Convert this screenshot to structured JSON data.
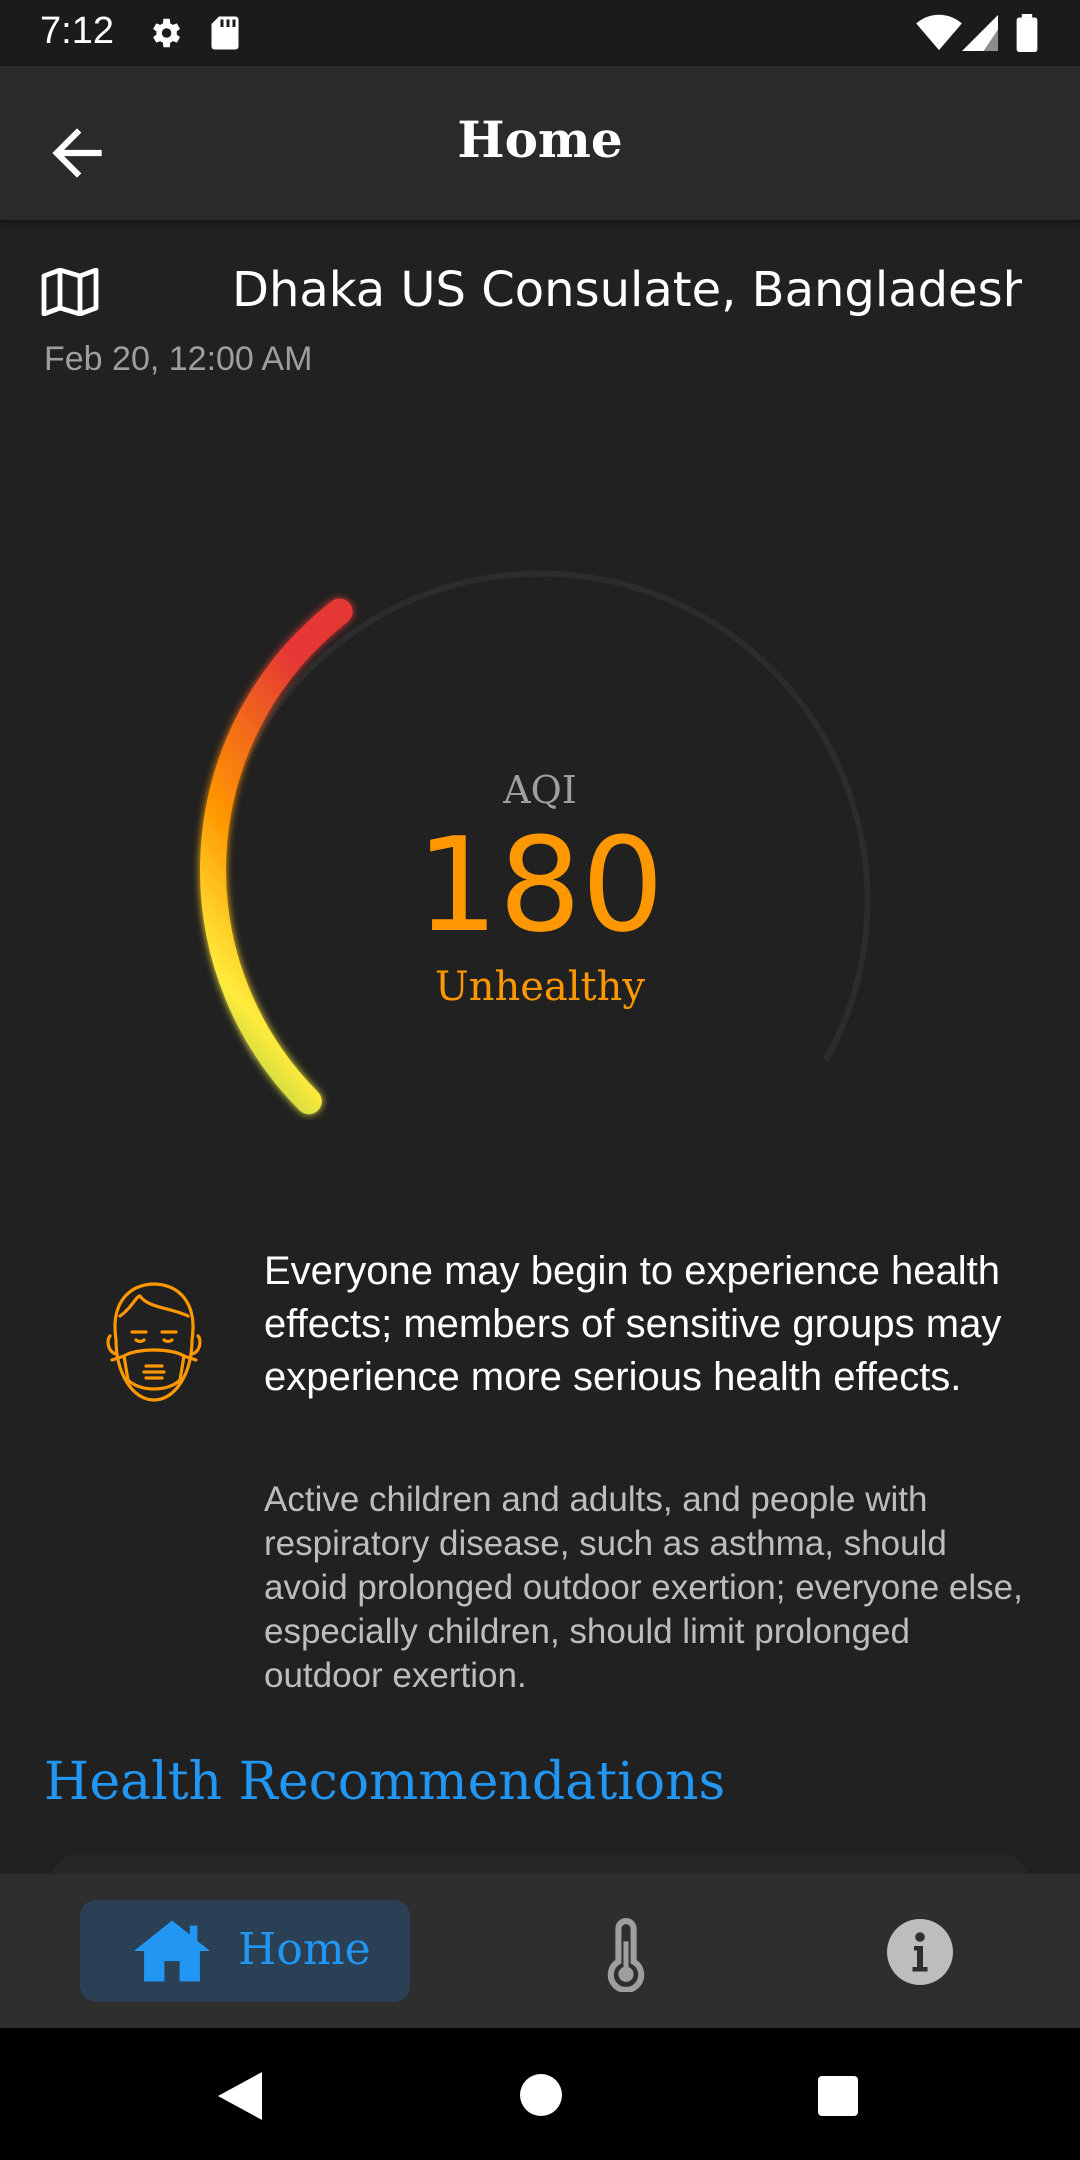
{
  "status_bar": {
    "time": "7:12"
  },
  "app_bar": {
    "title": "Home"
  },
  "location": {
    "name": "Dhaka US Consulate, Bangladesh",
    "timestamp": "Feb 20, 12:00 AM"
  },
  "aqi": {
    "label": "AQI",
    "value": "180",
    "category": "Unhealthy",
    "gauge_fraction": 0.36,
    "color": "#ff9800"
  },
  "health": {
    "effects": "Everyone may begin to experience health effects; members of sensitive groups may experience more serious health effects.",
    "cautionary": "Active children and adults, and people with respiratory disease, such as asthma, should avoid prolonged outdoor exertion; everyone else, especially children, should limit prolonged outdoor exertion."
  },
  "section": {
    "heading": "Health Recommendations"
  },
  "bottom_nav": {
    "items": [
      {
        "label": "Home",
        "icon": "home-icon",
        "active": true
      },
      {
        "label": "",
        "icon": "thermometer-icon",
        "active": false
      },
      {
        "label": "",
        "icon": "info-icon",
        "active": false
      }
    ]
  },
  "colors": {
    "accent": "#2196f3",
    "warning": "#ff9800",
    "background": "#212121"
  }
}
